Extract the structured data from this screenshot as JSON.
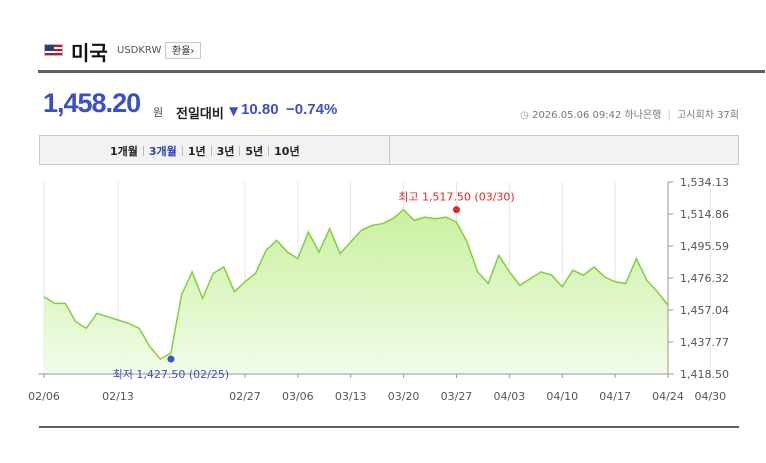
{
  "header": {
    "country": "미국",
    "code": "USDKRW",
    "fx_button": "환율›",
    "flag_icon": "us-flag-icon"
  },
  "quote": {
    "rate": "1,458.20",
    "unit": "원",
    "change_label": "전일대비",
    "change_direction_icon": "down-triangle-icon",
    "change_value": "10.80",
    "change_percent": "−0.74%",
    "meta_icon": "clock-icon",
    "datetime": "2026.05.06 09:42",
    "bank": "하나은행",
    "notice": "고시회차 37회"
  },
  "colors": {
    "accent": "#3c4fc6",
    "line": "#7fd13b",
    "fill_top": "#c9f0a0",
    "fill_bottom": "#f2fce8",
    "max_marker": "#e02828",
    "min_marker": "#3b54c8"
  },
  "tabs": [
    {
      "label": "1개월",
      "active": false
    },
    {
      "label": "3개월",
      "active": true
    },
    {
      "label": "1년",
      "active": false
    },
    {
      "label": "3년",
      "active": false
    },
    {
      "label": "5년",
      "active": false
    },
    {
      "label": "10년",
      "active": false
    }
  ],
  "chart_data": {
    "type": "area",
    "ylim": [
      1418.5,
      1534.13
    ],
    "y_ticks": [
      "1,534.13",
      "1,514.86",
      "1,495.59",
      "1,476.32",
      "1,457.04",
      "1,437.77",
      "1,418.50"
    ],
    "x_tick_labels": [
      "02/06",
      "02/13",
      "02/27",
      "03/06",
      "03/13",
      "03/20",
      "03/27",
      "04/03",
      "04/10",
      "04/17",
      "04/24",
      "04/30"
    ],
    "x_tick_index": [
      0,
      7,
      19,
      24,
      29,
      34,
      39,
      44,
      49,
      54,
      59,
      63
    ],
    "grid": "vertical",
    "annotations": {
      "max": {
        "label": "최고 1,517.50 (03/30)",
        "index": 39,
        "value": 1517.5
      },
      "min": {
        "label": "최저 1,427.50 (02/25)",
        "index": 12,
        "value": 1427.5
      }
    },
    "series": [
      {
        "values": [
          1465,
          1461,
          1461,
          1450,
          1446,
          1455,
          1453,
          1451,
          1449,
          1446,
          1435,
          1427.5,
          1431,
          1466,
          1480,
          1464,
          1479,
          1483,
          1468,
          1474,
          1479,
          1493,
          1499,
          1492,
          1488,
          1504,
          1492,
          1506,
          1491,
          1498,
          1505,
          1508,
          1509,
          1512,
          1517.5,
          1511,
          1513,
          1512,
          1513,
          1510,
          1498,
          1480,
          1473,
          1490,
          1480,
          1472,
          1476,
          1480,
          1478,
          1471,
          1481,
          1478,
          1483,
          1477,
          1474,
          1473,
          1488,
          1475,
          1468,
          1460
        ]
      }
    ]
  }
}
